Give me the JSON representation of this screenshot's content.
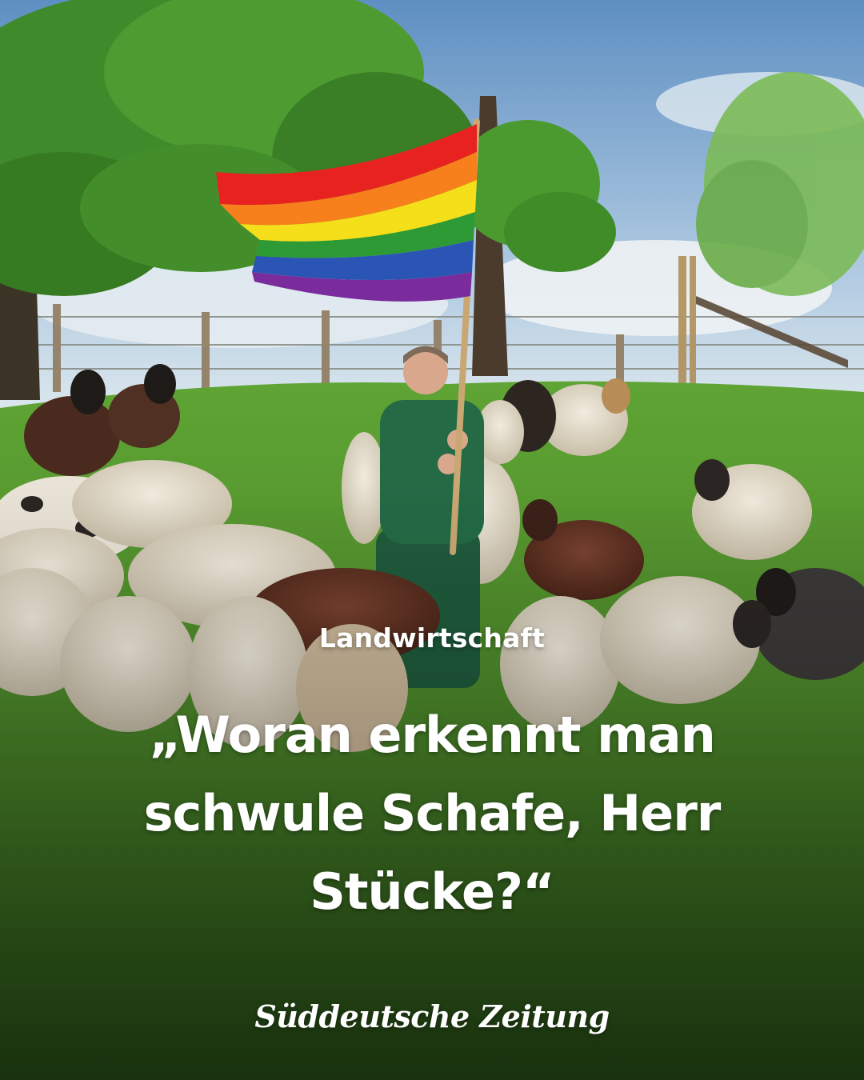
{
  "article": {
    "kicker": "Landwirtschaft",
    "headline_lines": [
      "„Woran erkennt man",
      "schwule Schafe, Herr",
      "Stücke?“"
    ]
  },
  "brand": {
    "name": "Süddeutsche Zeitung"
  },
  "photo": {
    "subject": "man holding rainbow flag among sheep on grassy hill",
    "flag_colors": [
      "#e8231f",
      "#f7801c",
      "#f5de1a",
      "#2e9a36",
      "#2a55b5",
      "#7a2c9c"
    ]
  },
  "colors": {
    "text": "#ffffff"
  }
}
